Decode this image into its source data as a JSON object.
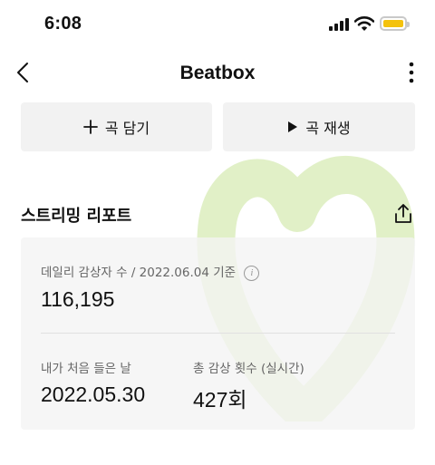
{
  "status_bar": {
    "time": "6:08",
    "icons": [
      "signal-icon",
      "wifi-icon",
      "battery-icon"
    ],
    "battery_color": "#f4c20d"
  },
  "nav": {
    "title": "Beatbox",
    "back_icon": "chevron-left-icon",
    "more_icon": "more-vertical-icon"
  },
  "actions": {
    "add_label": "곡 담기",
    "add_icon": "plus-icon",
    "play_label": "곡 재생",
    "play_icon": "play-icon"
  },
  "report": {
    "title": "스트리밍 리포트",
    "share_icon": "share-icon",
    "daily_listeners_label": "데일리 감상자 수 / 2022.06.04 기준",
    "info_icon_text": "i",
    "daily_listeners_value": "116,195",
    "first_listen_label": "내가 처음 들은 날",
    "first_listen_value": "2022.05.30",
    "total_plays_label": "총 감상 횟수 (실시간)",
    "total_plays_value": "427회"
  },
  "colors": {
    "button_bg": "#f2f2f2",
    "card_bg": "#f3f3f3",
    "watermark": "#d9ecb8"
  }
}
